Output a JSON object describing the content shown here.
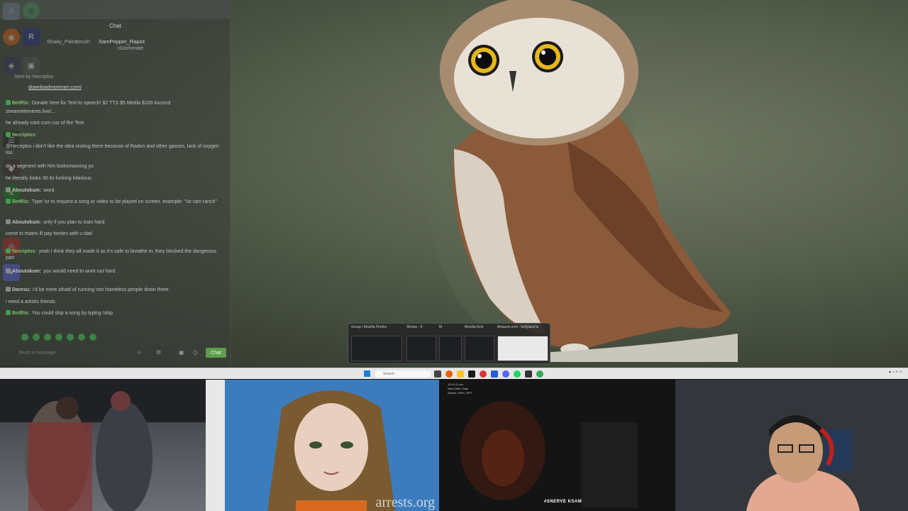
{
  "chat": {
    "title": "Chat",
    "pinned_users": [
      "Shaky_Paintbrush",
      "SamPepper_Rapist",
      "clutchmate"
    ],
    "sent_by_label": "Sent by",
    "sent_by_name": "Necriptos",
    "link": "downloadmoreram.com/",
    "messages": [
      {
        "name": "BotRix:",
        "text": "Donate here for Text to speech! $2 TTS $5 Media $100 Ascend",
        "color": "#7fc26a",
        "badge": "#3fa14b"
      },
      {
        "name": "",
        "text": "streamelements.live/...",
        "color": "#bfc4bf",
        "badge": ""
      },
      {
        "name": "",
        "text": "he already cant cum cuz of the Test",
        "color": "#bfc4bf",
        "badge": ""
      },
      {
        "name": "Necriptos:",
        "text": "",
        "color": "#7fc26a",
        "badge": "#3fa14b"
      },
      {
        "name": "",
        "text": "@Necriptos i don't like the idea visiting there because of Radon and other gasses, lack of oxygen too",
        "color": "#bfc4bf",
        "badge": ""
      },
      {
        "name": "",
        "text": "do a segment with him looksmaxxing yo",
        "color": "#bfc4bf",
        "badge": ""
      },
      {
        "name": "",
        "text": "he literally looks 30 its fucking hilarious",
        "color": "#bfc4bf",
        "badge": ""
      },
      {
        "name": "Aboutokum:",
        "text": "word",
        "color": "#bfc4bf",
        "badge": "#8a8a8a"
      },
      {
        "name": "BotRix:",
        "text": "Type !sr to request a song or video to be played on screen. example: \"!sr ram ranch\"",
        "color": "#7fc26a",
        "badge": "#3fa14b"
      },
      {
        "name": "Aboutokum:",
        "text": "only if you plan to train hard",
        "color": "#bfc4bf",
        "badge": "#8a8a8a"
      },
      {
        "name": "",
        "text": "come to miami ill pay tomies with u dad",
        "color": "#bfc4bf",
        "badge": ""
      },
      {
        "name": "Necriptos:",
        "text": "yeah I think they all made it so it's safe to breathe in, they blocked the dangerous part",
        "color": "#7fc26a",
        "badge": "#3fa14b"
      },
      {
        "name": "Aboutokum:",
        "text": "you would need to work out hard",
        "color": "#bfc4bf",
        "badge": "#8a8a8a"
      },
      {
        "name": "Daresu:",
        "text": "i'd be more afraid of running into homeless people down there",
        "color": "#bfc4bf",
        "badge": "#8a8a8a"
      },
      {
        "name": "",
        "text": "i need a artistic friends",
        "color": "#bfc4bf",
        "badge": ""
      },
      {
        "name": "BotRix:",
        "text": "You could skip a song by typing !skip",
        "color": "#7fc26a",
        "badge": "#3fa14b"
      }
    ],
    "input_placeholder": "Send a message",
    "send_label": "Chat"
  },
  "taskbar": {
    "search_placeholder": "Search",
    "thumbnails": [
      "Group | Mozilla Firefox",
      "Shows - K",
      "M",
      "Mozilla Kick",
      "Amazon.com : kellyland la"
    ]
  },
  "panels": {
    "cam2_watermark": "arrests.org",
    "cam3_label": "#SNERVE KSAM",
    "cam3_info": [
      "12:11:21 am",
      "New Delhi, India",
      "Smoke: 29% | 78°F"
    ]
  },
  "colors": {
    "accent_green": "#3fa14b",
    "taskbar_bg": "#e6e6e6",
    "chat_bg": "#3a3e3a"
  }
}
